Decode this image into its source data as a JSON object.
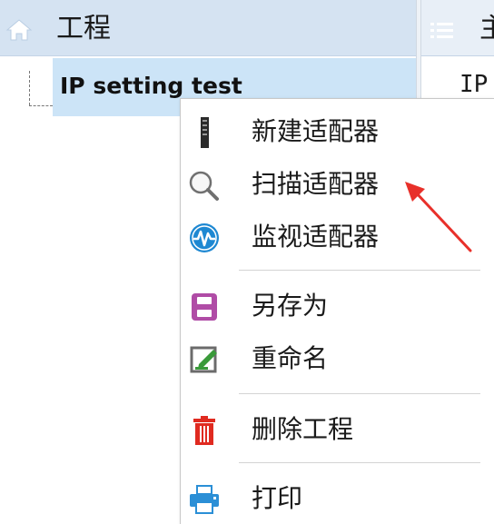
{
  "left_panel": {
    "title": "工程",
    "tree": {
      "root_label": "IP setting test"
    }
  },
  "right_panel": {
    "title_partial": "主",
    "content_partial": "IP"
  },
  "context_menu": {
    "groups": [
      {
        "items": [
          {
            "label": "新建适配器",
            "icon": "adapter-icon"
          },
          {
            "label": "扫描适配器",
            "icon": "magnifier-icon"
          },
          {
            "label": "监视适配器",
            "icon": "pulse-monitor-icon"
          }
        ]
      },
      {
        "items": [
          {
            "label": "另存为",
            "icon": "floppy-disk-icon"
          },
          {
            "label": "重命名",
            "icon": "edit-icon"
          }
        ]
      },
      {
        "items": [
          {
            "label": "删除工程",
            "icon": "trash-icon"
          }
        ]
      },
      {
        "items": [
          {
            "label": "打印",
            "icon": "printer-icon"
          }
        ]
      }
    ]
  },
  "colors": {
    "header_bg": "#d5e3f2",
    "selection_bg": "#cce4f7",
    "annotation_arrow": "#e8302a",
    "save_icon": "#b04ca6",
    "delete_icon": "#e02a20",
    "print_icon": "#2b8fd6",
    "monitor_icon": "#1e88d2"
  }
}
